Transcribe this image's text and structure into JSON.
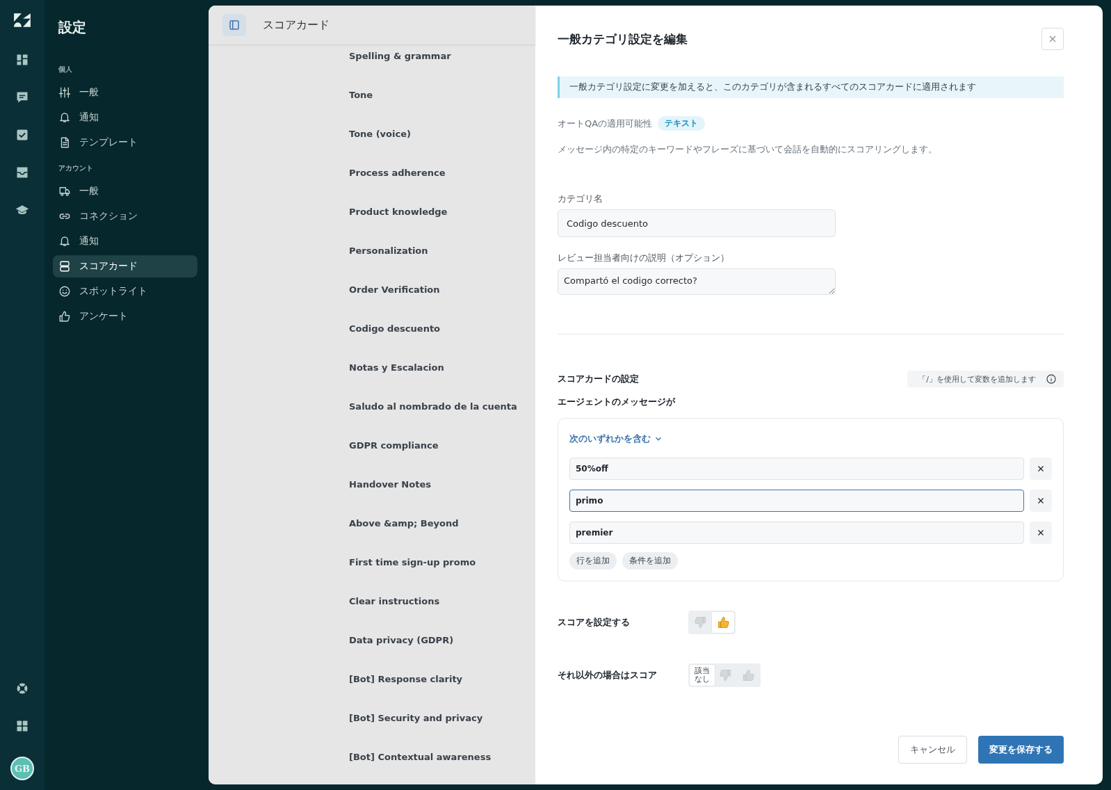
{
  "rail": {
    "top_icons": [
      {
        "kind": "dashboard",
        "selected": false
      },
      {
        "kind": "chat",
        "selected": false
      },
      {
        "kind": "task",
        "selected": false
      },
      {
        "kind": "inbox",
        "selected": false
      },
      {
        "kind": "learn",
        "selected": false
      }
    ],
    "bottom_icons": [
      {
        "kind": "help",
        "selected": false
      },
      {
        "kind": "apps",
        "selected": false
      }
    ],
    "avatar": "GB"
  },
  "sidebar": {
    "title": "設定",
    "sections": [
      {
        "label": "個人",
        "items": [
          {
            "kind": "sliders",
            "label": "一般",
            "selected": false
          },
          {
            "kind": "bell",
            "label": "通知",
            "selected": false
          },
          {
            "kind": "doc",
            "label": "テンプレート",
            "selected": false
          }
        ]
      },
      {
        "label": "アカウント",
        "items": [
          {
            "kind": "truck",
            "label": "一般",
            "selected": false
          },
          {
            "kind": "link",
            "label": "コネクション",
            "selected": false
          },
          {
            "kind": "bell",
            "label": "通知",
            "selected": false
          },
          {
            "kind": "cards",
            "label": "スコアカード",
            "selected": true
          },
          {
            "kind": "smile",
            "label": "スポットライト",
            "selected": false
          },
          {
            "kind": "thumb",
            "label": "アンケート",
            "selected": false
          }
        ]
      }
    ]
  },
  "list_panel": {
    "title": "スコアカード",
    "categories": [
      "Spelling & grammar",
      "Tone",
      "Tone (voice)",
      "Process adherence",
      "Product knowledge",
      "Personalization",
      "Order Verification",
      "Codigo descuento",
      "Notas y Escalacion",
      "Saludo al nombrado de la cuenta",
      "GDPR compliance",
      "Handover Notes",
      "Above &amp; Beyond",
      "First time sign-up promo",
      "Clear instructions",
      "Data privacy (GDPR)",
      "[Bot] Response clarity",
      "[Bot] Security and privacy",
      "[Bot] Contextual awareness"
    ]
  },
  "editor": {
    "title": "一般カテゴリ設定を編集",
    "notice": "一般カテゴリ設定に変更を加えると、このカテゴリが含まれるすべてのスコアカードに適用されます",
    "autoqa_label": "オートQAの適用可能性",
    "autoqa_tag": "テキスト",
    "autoqa_description": "メッセージ内の特定のキーワードやフレーズに基づいて会話を自動的にスコアリングします。",
    "name_field": {
      "label": "カテゴリ名",
      "value": "Codigo descuento"
    },
    "description_field": {
      "label": "レビュー担当者向けの説明（オプション）",
      "value": "Compartó el codigo correcto?"
    },
    "scorecard_settings": {
      "title": "スコアカードの設定",
      "variable_hint": "「/」を使用して変数を追加します",
      "subtitle": "エージェントのメッセージが",
      "condition": "次のいずれかを含む",
      "keywords": [
        {
          "value": "50%off",
          "focused": false
        },
        {
          "value": "primo",
          "focused": true
        },
        {
          "value": "premier",
          "focused": false
        }
      ],
      "add_buttons": [
        "行を追加",
        "条件を追加"
      ]
    },
    "score": {
      "label": "スコアを設定する",
      "options": [
        {
          "kind": "thumbs-down",
          "selected": false
        },
        {
          "kind": "thumbs-up",
          "selected": true
        }
      ]
    },
    "otherwise": {
      "label": "それ以外の場合はスコア",
      "options": [
        {
          "kind": "text",
          "label": "該当なし",
          "selected": true
        },
        {
          "kind": "thumbs-down",
          "selected": false
        },
        {
          "kind": "thumbs-up",
          "selected": false
        }
      ]
    },
    "buttons": {
      "cancel": "キャンセル",
      "save": "変更を保存する"
    }
  }
}
